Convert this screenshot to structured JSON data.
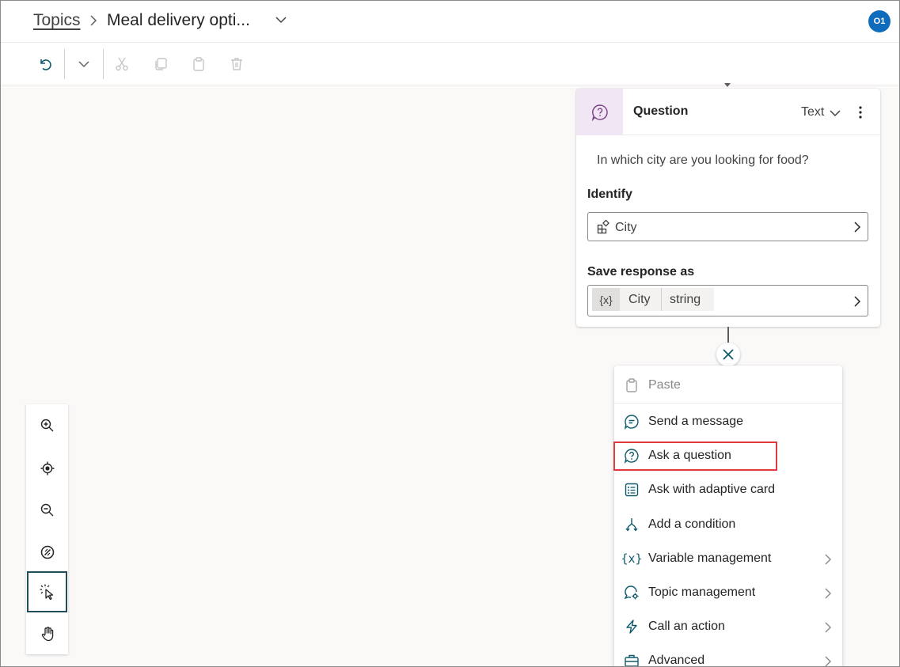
{
  "header": {
    "breadcrumb_root": "Topics",
    "breadcrumb_current": "Meal delivery opti...",
    "avatar_initials": "O1"
  },
  "toolbar": {
    "icons": [
      "undo-icon",
      "chevron-down-icon",
      "cut-icon",
      "copy-icon",
      "paste-icon",
      "delete-icon"
    ]
  },
  "question_node": {
    "title": "Question",
    "response_type": "Text",
    "prompt": "In which city are you looking for food?",
    "identify_label": "Identify",
    "identify_value": "City",
    "save_label": "Save response as",
    "variable_symbol": "{x}",
    "variable_name": "City",
    "variable_type": "string"
  },
  "add_node_menu": {
    "items": [
      {
        "label": "Paste",
        "icon": "paste-icon",
        "disabled": true
      },
      {
        "label": "Send a message",
        "icon": "chat-icon"
      },
      {
        "label": "Ask a question",
        "icon": "question-circle-icon"
      },
      {
        "label": "Ask with adaptive card",
        "icon": "adaptive-card-icon"
      },
      {
        "label": "Add a condition",
        "icon": "branch-icon"
      },
      {
        "label": "Variable management",
        "icon": "variable-icon",
        "submenu": true
      },
      {
        "label": "Topic management",
        "icon": "topic-settings-icon",
        "submenu": true
      },
      {
        "label": "Call an action",
        "icon": "lightning-icon",
        "submenu": true
      },
      {
        "label": "Advanced",
        "icon": "toolbox-icon",
        "submenu": true
      }
    ],
    "highlighted": "Ask a question"
  },
  "zoom_controls": {
    "icons": [
      "zoom-in-icon",
      "recenter-icon",
      "zoom-out-icon",
      "minimap-off-icon",
      "select-cursor-icon",
      "pan-hand-icon"
    ],
    "active": "select-cursor-icon"
  },
  "colors": {
    "accent": "#0f6cbd",
    "teal_icon": "#0f5b6c",
    "node_icon_bg": "#f1e6f3",
    "highlight": "#e0393e"
  }
}
